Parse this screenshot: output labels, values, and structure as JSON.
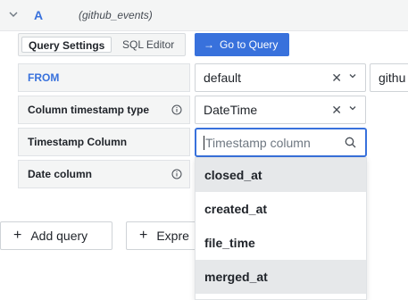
{
  "query": {
    "letter": "A",
    "datasource": "(github_events)"
  },
  "tabs": [
    {
      "label": "Query Settings",
      "active": true
    },
    {
      "label": "SQL Editor",
      "active": false
    }
  ],
  "goto_button": {
    "label": "Go to Query",
    "icon": "arrow-right-icon"
  },
  "rows": [
    {
      "label": "FROM",
      "value": "default",
      "extra_value": "githu"
    },
    {
      "label": "Column timestamp type",
      "value": "DateTime"
    },
    {
      "label": "Timestamp Column"
    },
    {
      "label": "Date column"
    }
  ],
  "search": {
    "placeholder": "Timestamp column",
    "value": ""
  },
  "options": [
    {
      "label": "closed_at",
      "highlighted": true
    },
    {
      "label": "created_at",
      "highlighted": false
    },
    {
      "label": "file_time",
      "highlighted": false
    },
    {
      "label": "merged_at",
      "highlighted": true
    }
  ],
  "add_query_label": "Add query",
  "expression_label": "Expre",
  "colors": {
    "accent": "#3871dc",
    "panel": "#f4f5f5",
    "highlight": "#e6e8ea"
  }
}
